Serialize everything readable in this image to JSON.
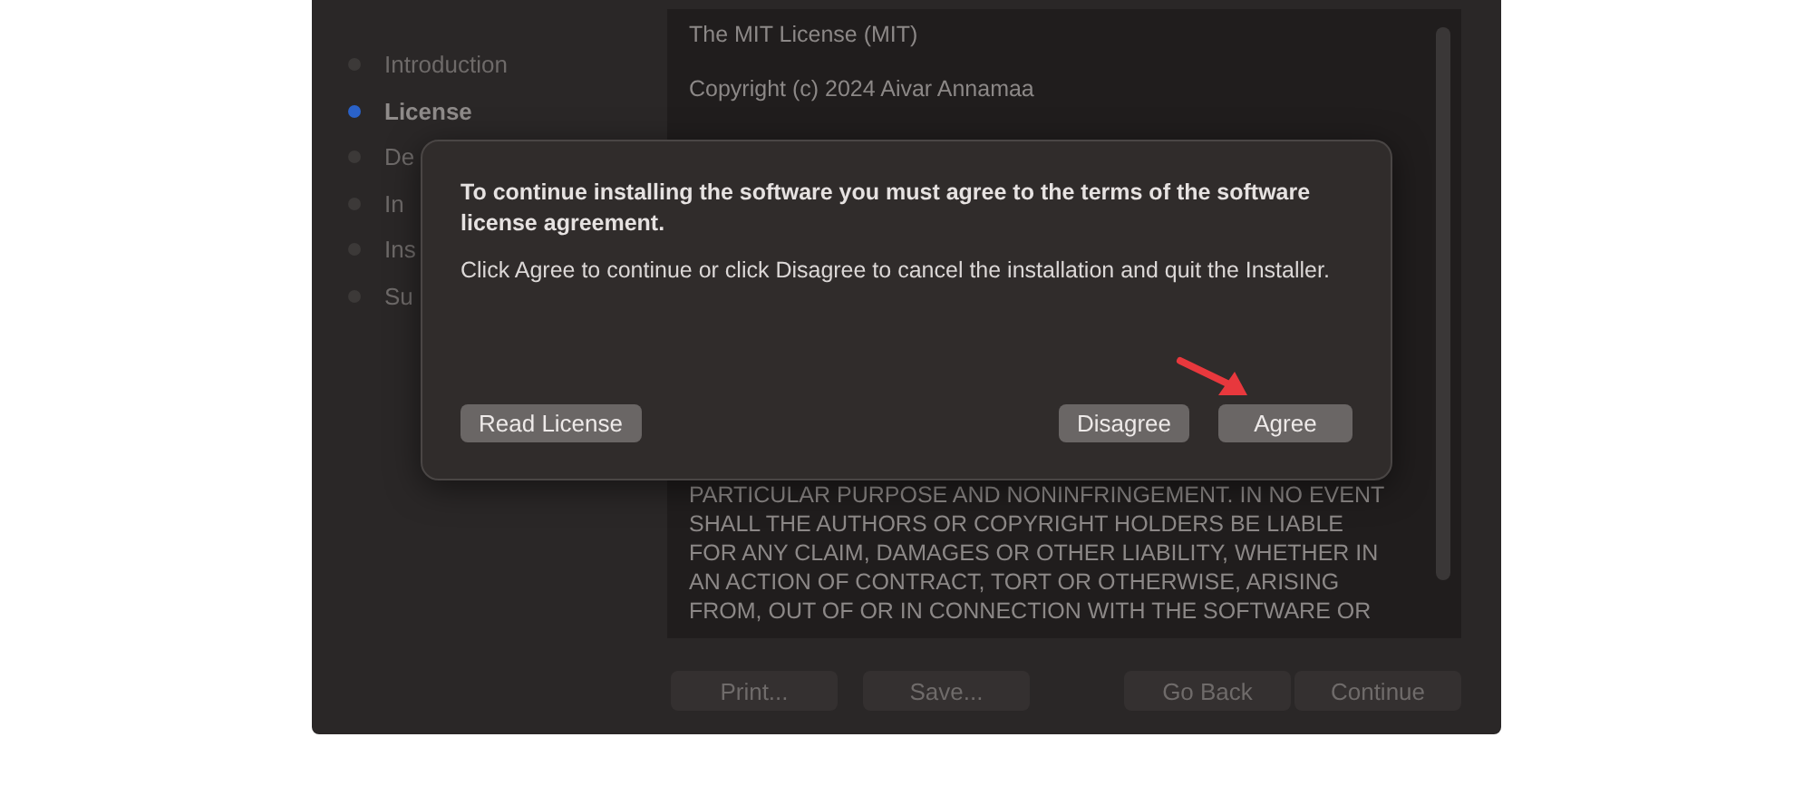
{
  "sidebar": {
    "items": [
      {
        "label": "Introduction",
        "selected": false
      },
      {
        "label": "License",
        "selected": true
      },
      {
        "label": "De",
        "selected": false
      },
      {
        "label": "In",
        "selected": false
      },
      {
        "label": "Ins",
        "selected": false
      },
      {
        "label": "Su",
        "selected": false
      }
    ]
  },
  "license_text": {
    "paragraphs": [
      "The MIT License (MIT)",
      "Copyright (c) 2024 Aivar Annamaa"
    ],
    "lines": [
      "PARTICULAR PURPOSE AND NONINFRINGEMENT.  IN NO EVENT",
      "SHALL THE AUTHORS OR COPYRIGHT HOLDERS BE LIABLE",
      "FOR ANY CLAIM, DAMAGES OR OTHER LIABILITY, WHETHER IN",
      "AN ACTION OF CONTRACT, TORT OR OTHERWISE, ARISING",
      "FROM, OUT OF OR IN CONNECTION WITH THE SOFTWARE OR"
    ]
  },
  "footer_buttons_left": [
    "Print...",
    "Save..."
  ],
  "footer_buttons_right": [
    "Go Back",
    "Continue"
  ],
  "dialog": {
    "heading": "To continue installing the software you must agree to the terms of the software license agreement.",
    "message": "Click Agree to continue or click Disagree to cancel the installation and quit the Installer.",
    "buttons_left": [
      "Read License"
    ],
    "buttons_right": [
      "Disagree",
      "Agree"
    ]
  }
}
